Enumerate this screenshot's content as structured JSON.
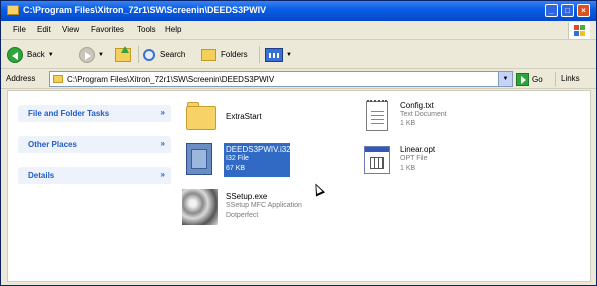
{
  "window": {
    "title": "C:\\Program Files\\Xitron_72r1\\SW\\Screenin\\DEEDS3PWIV",
    "minimize": "_",
    "maximize": "□",
    "close": "×"
  },
  "menu": [
    "File",
    "Edit",
    "View",
    "Favorites",
    "Tools",
    "Help"
  ],
  "toolbar": {
    "back": "Back",
    "search": "Search",
    "folders": "Folders"
  },
  "address": {
    "label": "Address",
    "path": "C:\\Program Files\\Xitron_72r1\\SW\\Screenin\\DEEDS3PWIV",
    "go": "Go",
    "links": "Links"
  },
  "tasks": [
    {
      "title": "File and Folder Tasks"
    },
    {
      "title": "Other Places"
    },
    {
      "title": "Details"
    }
  ],
  "files": {
    "extrastart": {
      "name": "ExtraStart"
    },
    "config": {
      "name": "Config.txt",
      "type": "Text Document",
      "size": "1 KB"
    },
    "deeds": {
      "name": "DEEDS3PWIV.i32",
      "type": "I32 File",
      "size": "67 KB"
    },
    "linear": {
      "name": "Linear.opt",
      "type": "OPT File",
      "size": "1 KB"
    },
    "ssetup": {
      "name": "SSetup.exe",
      "type": "SSetup MFC Application",
      "company": "Dotperfect"
    }
  },
  "chevron": "»",
  "colors": {
    "titlebar": "#0a5fe6",
    "selection": "#316ac5",
    "task_link": "#215dc6"
  }
}
